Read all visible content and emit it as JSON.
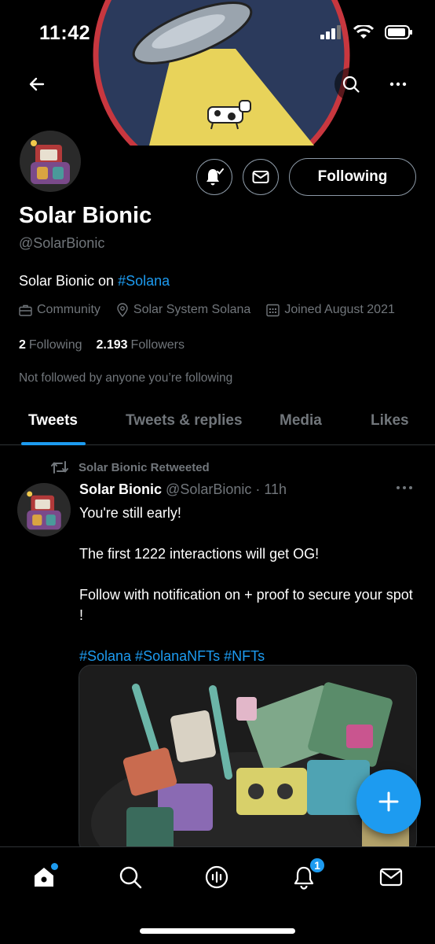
{
  "status_bar": {
    "time": "11:42"
  },
  "profile": {
    "name": "Solar Bionic",
    "handle": "@SolarBionic",
    "bio_text": "Solar Bionic on ",
    "bio_hashtag": "#Solana",
    "category": "Community",
    "location": "Solar System Solana",
    "joined": "Joined August 2021",
    "following_count": "2",
    "following_label": "Following",
    "followers_count": "2.193",
    "followers_label": "Followers",
    "not_followed_text": "Not followed by anyone you’re following",
    "following_button": "Following"
  },
  "tabs": [
    {
      "label": "Tweets",
      "active": true
    },
    {
      "label": "Tweets & replies",
      "active": false
    },
    {
      "label": "Media",
      "active": false
    },
    {
      "label": "Likes",
      "active": false
    }
  ],
  "tweet": {
    "retweet_label": "Solar Bionic Retweeted",
    "author_name": "Solar Bionic",
    "author_meta": "@SolarBionic · 11h",
    "line1": "You're still early!",
    "line2": "The first 1222 interactions will get OG!",
    "line3": "Follow with notification on + proof to secure your spot !",
    "hashtags": "#Solana #SolanaNFTs #NFTs"
  },
  "bottom_nav": {
    "notifications_badge": "1"
  },
  "colors": {
    "accent": "#1d9bf0",
    "background": "#000000",
    "muted_text": "#71767b"
  },
  "icons": [
    "back-arrow-icon",
    "search-icon",
    "more-icon",
    "bell-check-icon",
    "mail-icon",
    "briefcase-icon",
    "location-pin-icon",
    "calendar-icon",
    "retweet-icon",
    "plus-icon",
    "home-icon",
    "spaces-icon",
    "notifications-icon"
  ]
}
